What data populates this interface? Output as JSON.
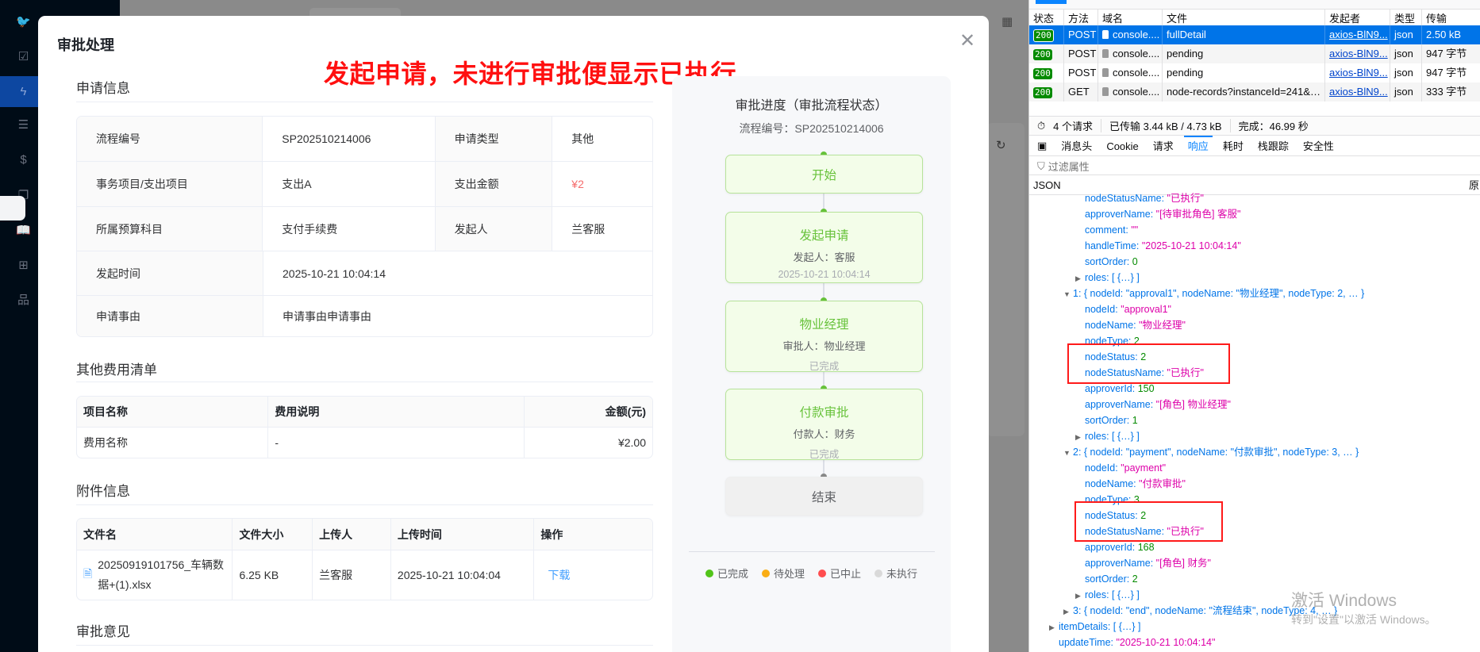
{
  "sidebar": {
    "icons": [
      "twitter-icon",
      "calendar-check-icon",
      "lightning-icon",
      "list-icon",
      "dollar-icon",
      "copy-icon",
      "book-icon",
      "apps-add-icon",
      "sitemap-icon"
    ],
    "active_index": 2,
    "active_color": "#0d47a1"
  },
  "modal": {
    "title": "审批处理",
    "annotation": "发起申请，未进行审批便显示已执行",
    "annotation_color": "#ff0000",
    "sections": {
      "apply_info": "申请信息",
      "other_fees": "其他费用清单",
      "attachments": "附件信息",
      "opinion": "审批意见"
    },
    "apply_info": [
      [
        {
          "label": "流程编号",
          "value": "SP202510214006"
        },
        {
          "label": "申请类型",
          "value": "其他"
        }
      ],
      [
        {
          "label": "事务项目/支出项目",
          "value": "支出A"
        },
        {
          "label": "支出金额",
          "value": "¥2",
          "highlight": "#f56c6c"
        }
      ],
      [
        {
          "label": "所属预算科目",
          "value": "支付手续费"
        },
        {
          "label": "发起人",
          "value": "兰客服"
        }
      ],
      [
        {
          "label": "发起时间",
          "value": "2025-10-21 10:04:14"
        }
      ],
      [
        {
          "label": "申请事由",
          "value": "申请事由申请事由"
        }
      ]
    ],
    "fee_table": {
      "headers": [
        "项目名称",
        "费用说明",
        "金额(元)"
      ],
      "rows": [
        [
          "费用名称",
          "-",
          "¥2.00"
        ]
      ]
    },
    "attachment_table": {
      "headers": [
        "文件名",
        "文件大小",
        "上传人",
        "上传时间",
        "操作"
      ],
      "rows": [
        {
          "file": "20250919101756_车辆数据+(1).xlsx",
          "size": "6.25 KB",
          "uploader": "兰客服",
          "time": "2025-10-21 10:04:04",
          "action": "下载"
        }
      ]
    }
  },
  "flow": {
    "title": "审批进度（审批流程状态）",
    "process_no": "流程编号：SP202510214006",
    "nodes": [
      {
        "name": "开始",
        "status": "completed"
      },
      {
        "name": "发起申请",
        "sub": "发起人：客服",
        "sub2": "2025-10-21 10:04:14",
        "status": "completed"
      },
      {
        "name": "物业经理",
        "sub": "审批人：物业经理",
        "sub2": "已完成",
        "status": "completed"
      },
      {
        "name": "付款审批",
        "sub": "付款人：财务",
        "sub2": "已完成",
        "status": "completed"
      },
      {
        "name": "结束",
        "status": "not-executed"
      }
    ],
    "legend": [
      {
        "label": "已完成",
        "color": "#52c41a"
      },
      {
        "label": "待处理",
        "color": "#faad14"
      },
      {
        "label": "已中止",
        "color": "#ff4d4f"
      },
      {
        "label": "未执行",
        "color": "#d9d9d9"
      }
    ]
  },
  "devtools": {
    "columns": [
      "状态",
      "方法",
      "域名",
      "文件",
      "发起者",
      "类型",
      "传输"
    ],
    "requests": [
      {
        "status": "200",
        "method": "POST",
        "domain": "console....",
        "file": "fullDetail",
        "initiator": "axios-BlN9...",
        "type": "json",
        "transfer": "2.50 kB",
        "selected": true
      },
      {
        "status": "200",
        "method": "POST",
        "domain": "console....",
        "file": "pending",
        "initiator": "axios-BlN9...",
        "type": "json",
        "transfer": "947 字节"
      },
      {
        "status": "200",
        "method": "POST",
        "domain": "console....",
        "file": "pending",
        "initiator": "axios-BlN9...",
        "type": "json",
        "transfer": "947 字节"
      },
      {
        "status": "200",
        "method": "GET",
        "domain": "console....",
        "file": "node-records?instanceId=241&nodeId",
        "initiator": "axios-BlN9...",
        "type": "json",
        "transfer": "333 字节"
      }
    ],
    "summary": {
      "requests": "4 个请求",
      "transferred": "已传输 3.44 kB / 4.73 kB",
      "finish": "完成：46.99 秒"
    },
    "tabs": [
      "消息头",
      "Cookie",
      "请求",
      "响应",
      "耗时",
      "栈跟踪",
      "安全性"
    ],
    "active_tab": "响应",
    "filter_placeholder": "过滤属性",
    "json_label": "JSON",
    "raw_label": "原",
    "json_lines": [
      {
        "depth": 3,
        "key": "nodeStatusName",
        "value": "\"已执行\"",
        "kind": "string"
      },
      {
        "depth": 3,
        "key": "approverName",
        "value": "\"[待审批角色] 客服\"",
        "kind": "string"
      },
      {
        "depth": 3,
        "key": "comment",
        "value": "\"\"",
        "kind": "string"
      },
      {
        "depth": 3,
        "key": "handleTime",
        "value": "\"2025-10-21 10:04:14\"",
        "kind": "string"
      },
      {
        "depth": 3,
        "key": "sortOrder",
        "value": "0",
        "kind": "number"
      },
      {
        "depth": 3,
        "key": "roles",
        "value": "[ {…} ]",
        "kind": "collapsed",
        "toggle": "closed"
      },
      {
        "depth": 2,
        "key": "1",
        "value": "{ nodeId: \"approval1\", nodeName: \"物业经理\", nodeType: 2, … }",
        "kind": "summary",
        "toggle": "open"
      },
      {
        "depth": 3,
        "key": "nodeId",
        "value": "\"approval1\"",
        "kind": "string"
      },
      {
        "depth": 3,
        "key": "nodeName",
        "value": "\"物业经理\"",
        "kind": "string"
      },
      {
        "depth": 3,
        "key": "nodeType",
        "value": "2",
        "kind": "number"
      },
      {
        "depth": 3,
        "key": "nodeStatus",
        "value": "2",
        "kind": "number"
      },
      {
        "depth": 3,
        "key": "nodeStatusName",
        "value": "\"已执行\"",
        "kind": "string"
      },
      {
        "depth": 3,
        "key": "approverId",
        "value": "150",
        "kind": "number"
      },
      {
        "depth": 3,
        "key": "approverName",
        "value": "\"[角色] 物业经理\"",
        "kind": "string"
      },
      {
        "depth": 3,
        "key": "sortOrder",
        "value": "1",
        "kind": "number"
      },
      {
        "depth": 3,
        "key": "roles",
        "value": "[ {…} ]",
        "kind": "collapsed",
        "toggle": "closed"
      },
      {
        "depth": 2,
        "key": "2",
        "value": "{ nodeId: \"payment\", nodeName: \"付款审批\", nodeType: 3, … }",
        "kind": "summary",
        "toggle": "open"
      },
      {
        "depth": 3,
        "key": "nodeId",
        "value": "\"payment\"",
        "kind": "string"
      },
      {
        "depth": 3,
        "key": "nodeName",
        "value": "\"付款审批\"",
        "kind": "string"
      },
      {
        "depth": 3,
        "key": "nodeType",
        "value": "3",
        "kind": "number"
      },
      {
        "depth": 3,
        "key": "nodeStatus",
        "value": "2",
        "kind": "number"
      },
      {
        "depth": 3,
        "key": "nodeStatusName",
        "value": "\"已执行\"",
        "kind": "string"
      },
      {
        "depth": 3,
        "key": "approverId",
        "value": "168",
        "kind": "number"
      },
      {
        "depth": 3,
        "key": "approverName",
        "value": "\"[角色] 财务\"",
        "kind": "string"
      },
      {
        "depth": 3,
        "key": "sortOrder",
        "value": "2",
        "kind": "number"
      },
      {
        "depth": 3,
        "key": "roles",
        "value": "[ {…} ]",
        "kind": "collapsed",
        "toggle": "closed"
      },
      {
        "depth": 2,
        "key": "3",
        "value": "{ nodeId: \"end\", nodeName: \"流程结束\", nodeType: 4, … }",
        "kind": "summary",
        "toggle": "closed"
      },
      {
        "depth": 1,
        "key": "itemDetails",
        "value": "[ {…} ]",
        "kind": "collapsed",
        "toggle": "closed"
      },
      {
        "depth": 1,
        "key": "updateTime",
        "value": "\"2025-10-21 10:04:14\"",
        "kind": "string"
      }
    ],
    "highlight_color": "#ff1a1a"
  },
  "watermark": {
    "line1": "激活 Windows",
    "line2": "转到\"设置\"以激活 Windows。"
  }
}
